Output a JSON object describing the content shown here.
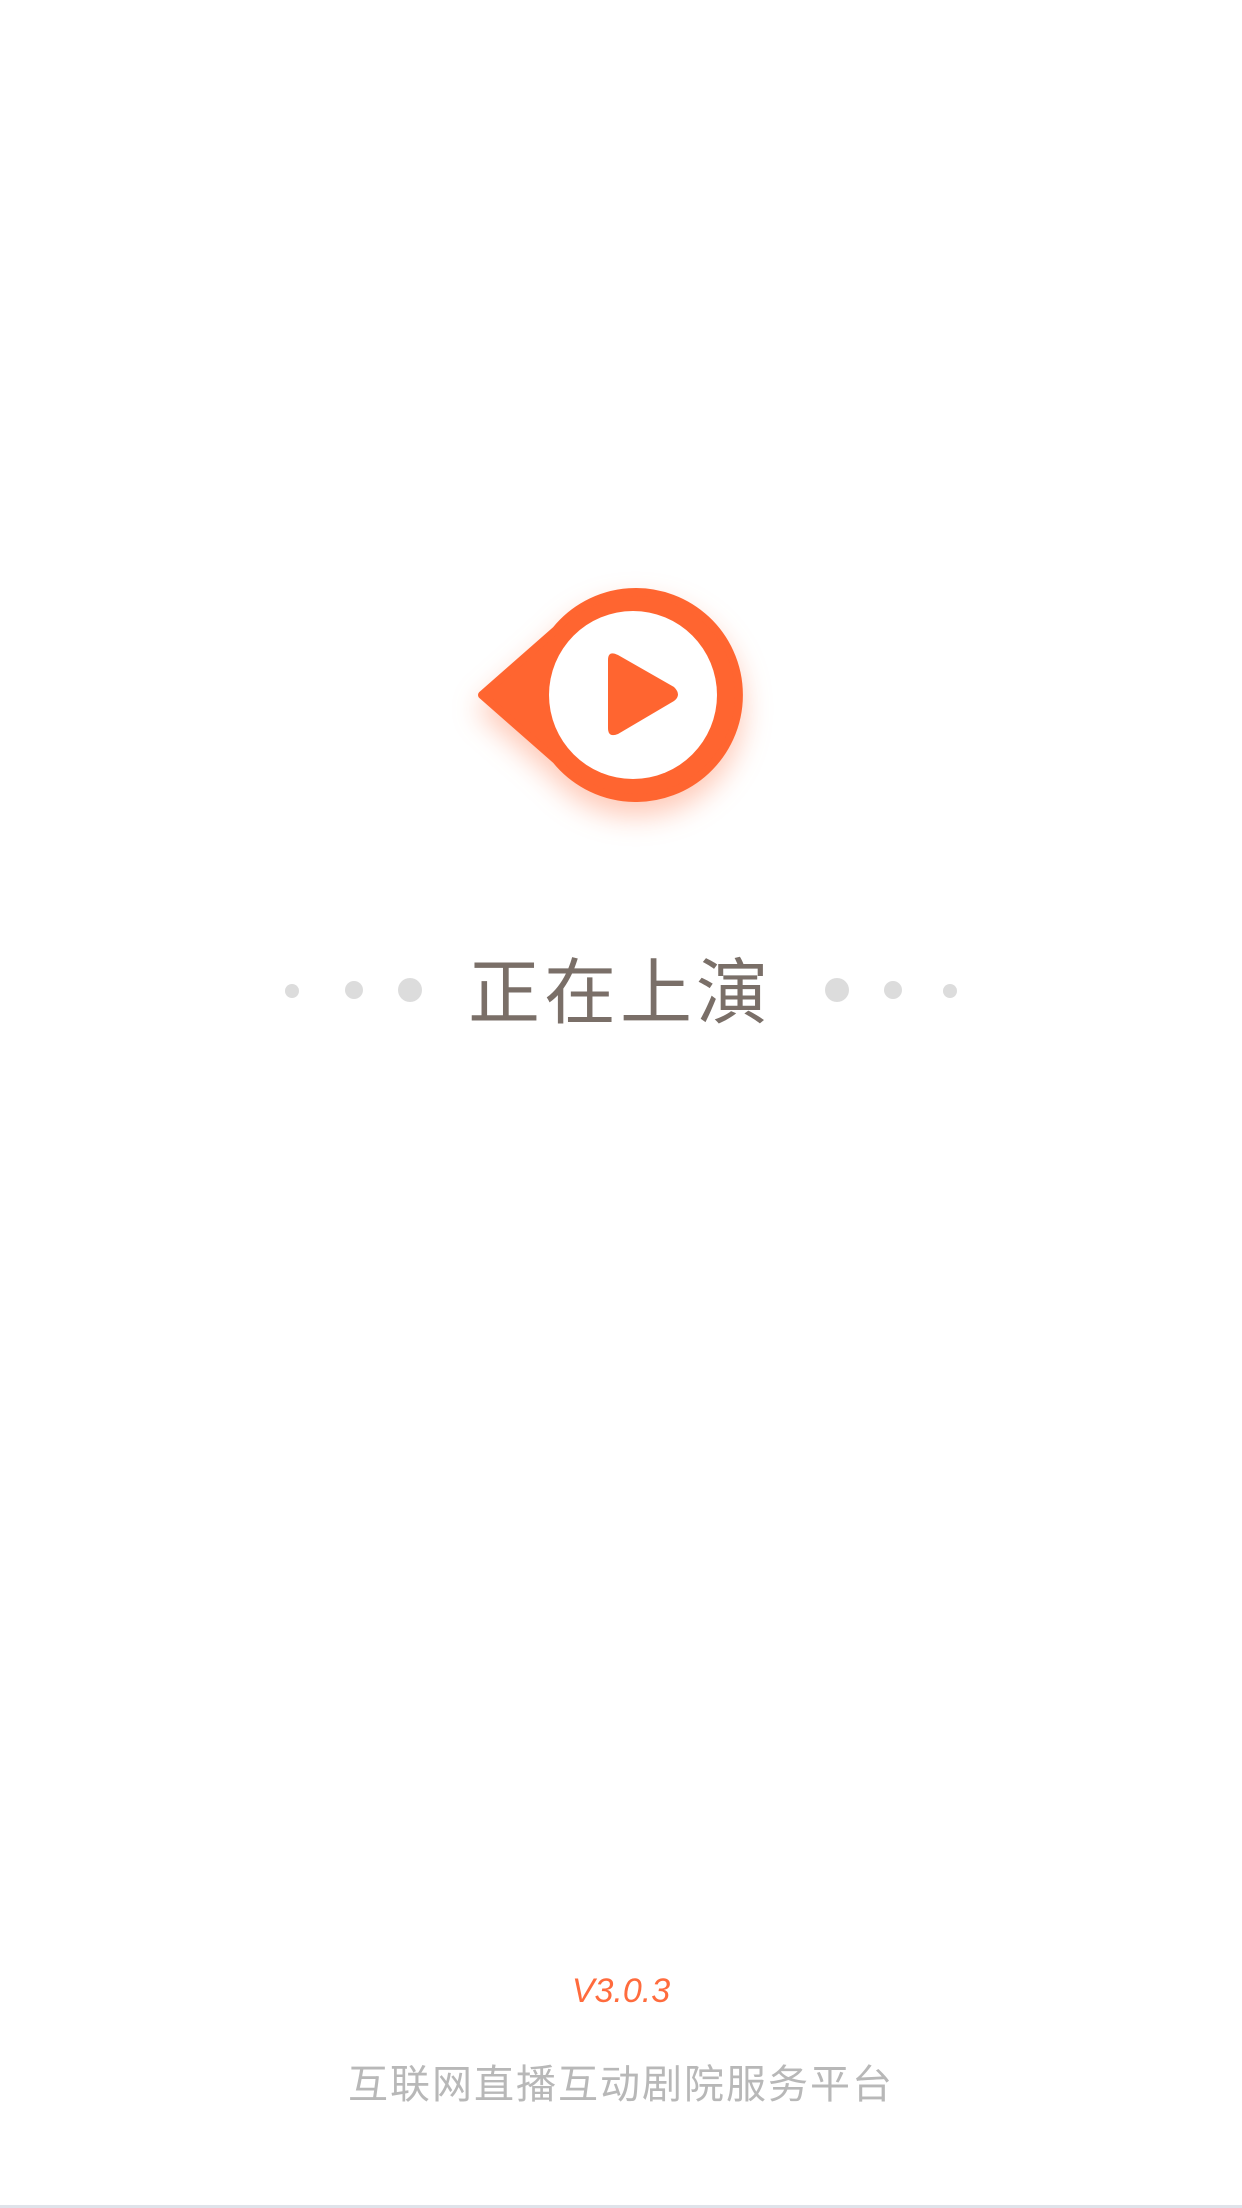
{
  "app": {
    "slogan": "正在上演",
    "version": "V3.0.3",
    "platform_description": "互联网直播互动剧院服务平台"
  },
  "logo": {
    "icon": "play-button-icon",
    "accent_color": "#ff6530"
  },
  "colors": {
    "background": "#ffffff",
    "slogan_text": "#7a6f68",
    "version_text": "#ff6b3d",
    "platform_text": "#b8b8b8",
    "decorative_dots": "#dcdcdc"
  }
}
